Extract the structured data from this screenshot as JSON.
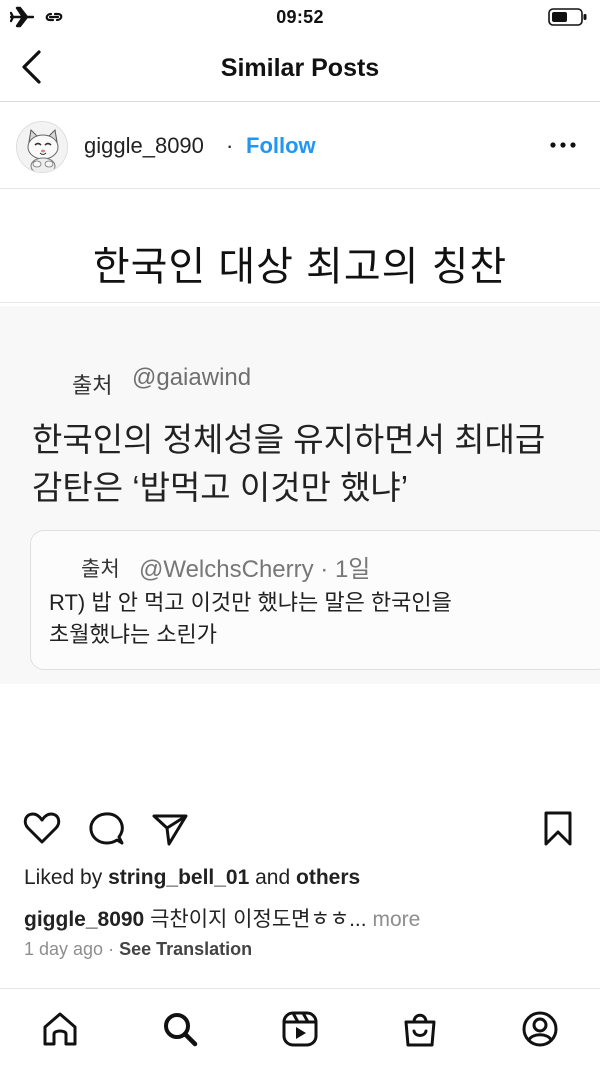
{
  "status_bar": {
    "time": "09:52",
    "icons": [
      "airplane-icon",
      "link-icon",
      "battery-icon"
    ]
  },
  "nav": {
    "title": "Similar Posts",
    "back_icon": "chevron-left-icon"
  },
  "post": {
    "username": "giggle_8090",
    "separator": "·",
    "follow_label": "Follow",
    "follow_color": "#2196f3",
    "more_icon": "more-horizontal-icon",
    "image": {
      "headline": "한국인 대상 최고의 칭찬",
      "tweet": {
        "source_label": "출처",
        "source_handle": "@gaiawind",
        "text_line1": "한국인의 정체성을 유지하면서 최대급",
        "text_line2": "감탄은 ‘밥먹고 이것만 했냐’"
      },
      "quoted_tweet": {
        "source_label": "출처",
        "source_handle": "@WelchsCherry · 1일",
        "text_line1": "RT) 밥 안 먹고 이것만 했냐는 말은 한국인을",
        "text_line2": "초월했냐는 소린가"
      }
    },
    "actions": [
      "heart-icon",
      "comment-icon",
      "share-icon",
      "bookmark-icon"
    ],
    "likes": {
      "prefix": "Liked by ",
      "user": "string_bell_01",
      "middle": " and ",
      "others": "others"
    },
    "caption": {
      "user": "giggle_8090",
      "text": " 극찬이지 이정도면ㅎㅎ... ",
      "more_label": "more"
    },
    "time_ago": "1 day ago",
    "time_sep": " · ",
    "see_translation": "See Translation"
  },
  "tab_bar": {
    "tabs": [
      "home-icon",
      "search-icon",
      "reels-icon",
      "shop-icon",
      "profile-icon"
    ]
  }
}
